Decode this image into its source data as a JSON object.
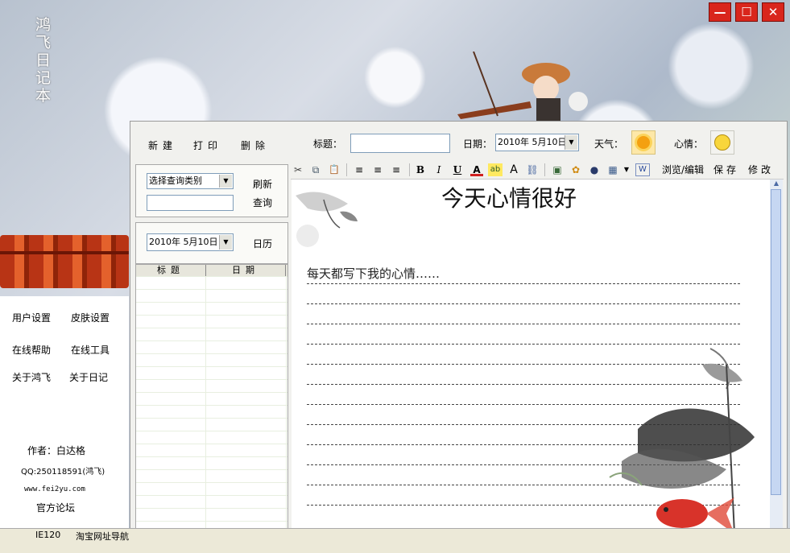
{
  "app": {
    "side_title": "鸿飞日记本"
  },
  "window_controls": {
    "minimize": "—",
    "maximize": "☐",
    "close": "✕"
  },
  "top_actions": {
    "new": "新建",
    "print": "打印",
    "delete": "删除"
  },
  "entry": {
    "title_label": "标题：",
    "title_value": "",
    "date_label": "日期：",
    "date_value": "2010年 5月10日",
    "weather_label": "天气：",
    "mood_label": "心情："
  },
  "query": {
    "category_select": "选择查询类别",
    "search_value": "",
    "refresh": "刷新",
    "search": "查询"
  },
  "calendar": {
    "date_value": "2010年 5月10日",
    "button": "日历"
  },
  "list": {
    "columns": [
      "标题",
      "日期"
    ],
    "rows": []
  },
  "toolbar": {
    "cut_icon": "✂",
    "copy_icon": "⧉",
    "paste_icon": "📋",
    "align_left_icon": "≡",
    "align_center_icon": "≡",
    "align_right_icon": "≡",
    "bold": "B",
    "italic": "I",
    "underline": "U",
    "font_color": "A",
    "highlight": "ab",
    "font_size": "A",
    "link_icon": "⛓",
    "image_icon": "▣",
    "special_icon": "✿",
    "flash_icon": "●",
    "table_icon": "▦",
    "word_icon": "W",
    "preview_edit": "浏览/编辑",
    "save": "保存",
    "modify": "修改"
  },
  "document": {
    "heading": "今天心情很好",
    "first_line": "每天都写下我的心情……"
  },
  "left_menu": {
    "user_settings": "用户设置",
    "skin_settings": "皮肤设置",
    "online_help": "在线帮助",
    "online_tools": "在线工具",
    "about_hongfei": "关于鸿飞",
    "about_diary": "关于日记"
  },
  "credits": {
    "author": "作者：白达格",
    "qq": "QQ:250118591(鸿飞)",
    "website": "www.fei2yu.com",
    "forum": "官方论坛"
  },
  "statusbar": {
    "ie": "IE120",
    "taobao": "淘宝网址导航"
  },
  "colors": {
    "window_button": "#d9261c",
    "paper_ruled_line": "#444444"
  }
}
